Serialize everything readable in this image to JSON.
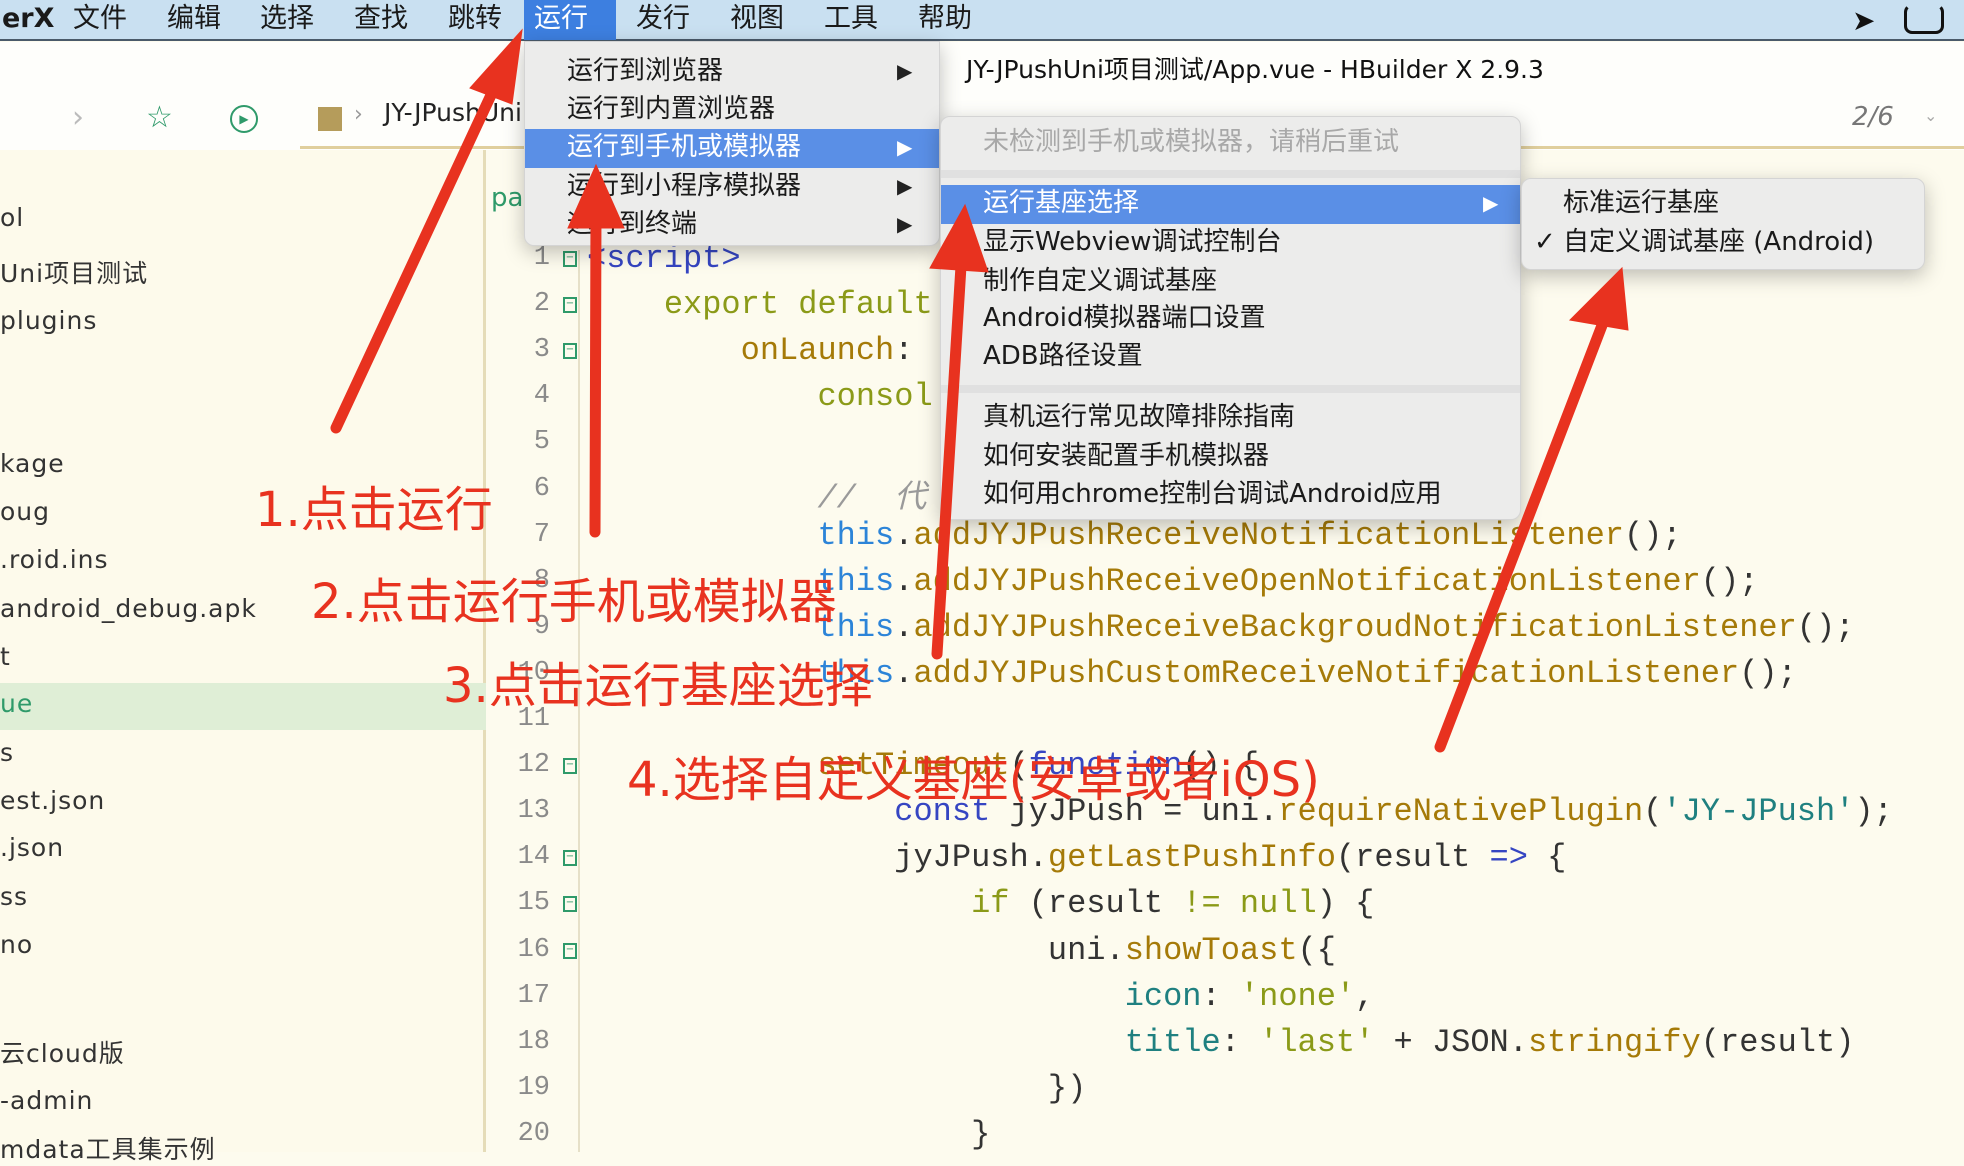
{
  "menubar": {
    "app": "erX",
    "items": [
      "文件",
      "编辑",
      "选择",
      "查找",
      "跳转",
      "运行",
      "发行",
      "视图",
      "工具",
      "帮助"
    ],
    "active": "运行"
  },
  "window": {
    "title": "JY-JPushUni项目测试/App.vue - HBuilder X 2.9.3"
  },
  "toolbar": {
    "breadcrumb": "JY-JPushUni",
    "pager": "2/6"
  },
  "sidebar": {
    "items": [
      "ol",
      "Uni项目测试",
      "plugins",
      "kage",
      "oug",
      ".roid.ins",
      "android_debug.apk",
      "t",
      "ue",
      "s",
      "est.json",
      ".json",
      "ss",
      "no",
      "云cloud版",
      "-admin",
      "mdata工具集示例"
    ],
    "selected": "ue"
  },
  "editor": {
    "lines": [
      {
        "n": "1",
        "tokens": [
          [
            "<script>",
            "tag"
          ]
        ]
      },
      {
        "n": "2",
        "tokens": [
          [
            "    export default",
            "ol"
          ]
        ]
      },
      {
        "n": "3",
        "tokens": [
          [
            "        onLaunch",
            "fn"
          ],
          [
            ":",
            ""
          ]
        ]
      },
      {
        "n": "4",
        "tokens": [
          [
            "            consol",
            "ol"
          ]
        ]
      },
      {
        "n": "5",
        "tokens": []
      },
      {
        "n": "6",
        "tokens": [
          [
            "            //  代",
            "cm"
          ]
        ]
      },
      {
        "n": "7",
        "tokens": [
          [
            "            this",
            "th"
          ],
          [
            ".",
            ""
          ],
          [
            "addJYJPushReceiveNotificationListener",
            "fn"
          ],
          [
            "();",
            ""
          ]
        ]
      },
      {
        "n": "8",
        "tokens": [
          [
            "            this",
            "th"
          ],
          [
            ".",
            ""
          ],
          [
            "addJYJPushReceiveOpenNotificationListener",
            "fn"
          ],
          [
            "();",
            ""
          ]
        ]
      },
      {
        "n": "9",
        "tokens": [
          [
            "            this",
            "th"
          ],
          [
            ".",
            ""
          ],
          [
            "addJYJPushReceiveBackgroudNotificationListener",
            "fn"
          ],
          [
            "();",
            ""
          ]
        ]
      },
      {
        "n": "10",
        "tokens": [
          [
            "            this",
            "th"
          ],
          [
            ".",
            ""
          ],
          [
            "addJYJPushCustomReceiveNotificationListener",
            "fn"
          ],
          [
            "();",
            ""
          ]
        ]
      },
      {
        "n": "11",
        "tokens": []
      },
      {
        "n": "12",
        "tokens": [
          [
            "            setTimeout",
            "fn"
          ],
          [
            "(",
            ""
          ],
          [
            "function",
            "kw"
          ],
          [
            "() {",
            ""
          ]
        ]
      },
      {
        "n": "13",
        "tokens": [
          [
            "                const",
            "kw"
          ],
          [
            " jyJPush = uni.",
            ""
          ],
          [
            "requireNativePlugin",
            "fn"
          ],
          [
            "(",
            ""
          ],
          [
            "'JY-JPush'",
            "st"
          ],
          [
            ");",
            ""
          ]
        ]
      },
      {
        "n": "14",
        "tokens": [
          [
            "                jyJPush.",
            ""
          ],
          [
            "getLastPushInfo",
            "fn"
          ],
          [
            "(result ",
            ""
          ],
          [
            "=>",
            "op"
          ],
          [
            " {",
            ""
          ]
        ]
      },
      {
        "n": "15",
        "tokens": [
          [
            "                    if",
            "ol"
          ],
          [
            " (result ",
            ""
          ],
          [
            "!=",
            "ol"
          ],
          [
            " ",
            ""
          ],
          [
            "null",
            "ol"
          ],
          [
            ") {",
            ""
          ]
        ]
      },
      {
        "n": "16",
        "tokens": [
          [
            "                        uni.",
            ""
          ],
          [
            "showToast",
            "fn"
          ],
          [
            "({",
            ""
          ]
        ]
      },
      {
        "n": "17",
        "tokens": [
          [
            "                            icon",
            "pr"
          ],
          [
            ": ",
            ""
          ],
          [
            "'none'",
            "ol"
          ],
          [
            ",",
            ""
          ]
        ]
      },
      {
        "n": "18",
        "tokens": [
          [
            "                            title",
            "pr"
          ],
          [
            ": ",
            ""
          ],
          [
            "'last'",
            "ol"
          ],
          [
            " + JSON.",
            ""
          ],
          [
            "stringify",
            "fn"
          ],
          [
            "(result)",
            ""
          ]
        ]
      },
      {
        "n": "19",
        "tokens": [
          [
            "                        })",
            ""
          ]
        ]
      },
      {
        "n": "20",
        "tokens": [
          [
            "                    }",
            ""
          ]
        ]
      }
    ]
  },
  "run_menu": {
    "items": [
      {
        "label": "运行到浏览器",
        "submenu": true
      },
      {
        "label": "运行到内置浏览器",
        "submenu": false
      },
      {
        "label": "运行到手机或模拟器",
        "submenu": true,
        "highlighted": true
      },
      {
        "label": "运行到小程序模拟器",
        "submenu": true
      },
      {
        "label": "运行到终端",
        "submenu": true
      }
    ]
  },
  "device_menu": {
    "disabled": "未检测到手机或模拟器，请稍后重试",
    "items": [
      "运行基座选择",
      "显示Webview调试控制台",
      "制作自定义调试基座",
      "Android模拟器端口设置",
      "ADB路径设置"
    ],
    "help_items": [
      "真机运行常见故障排除指南",
      "如何安装配置手机模拟器",
      "如何用chrome控制台调试Android应用"
    ],
    "highlighted": "运行基座选择"
  },
  "base_menu": {
    "items": [
      {
        "label": "标准运行基座",
        "checked": false
      },
      {
        "label": "自定义调试基座 (Android)",
        "checked": true
      }
    ],
    "check": "✓"
  },
  "annotations": [
    "1.点击运行",
    "2.点击运行手机或模拟器",
    "3.点击运行基座选择",
    "4.选择自定义基座(安卓或者iOS)"
  ],
  "colors": {
    "annotation": "#e8321f",
    "menu_highlight": "#5a8fe6",
    "menubar_active": "#3d7fe0"
  }
}
